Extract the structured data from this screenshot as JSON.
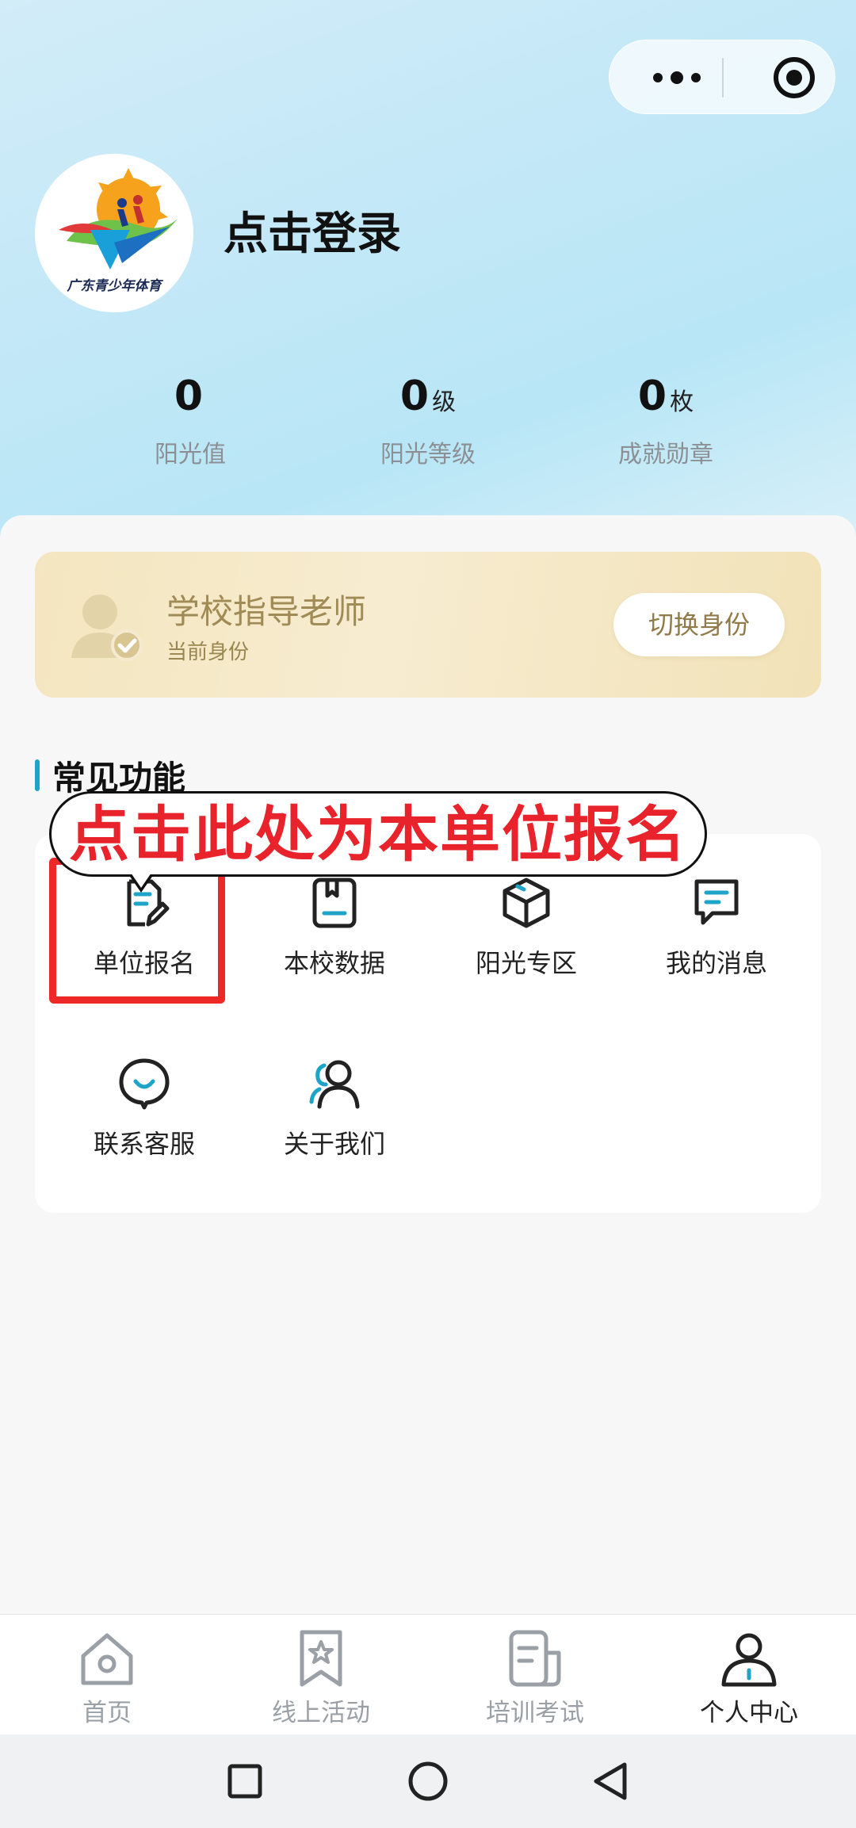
{
  "capsule": {
    "more_icon": "more-dots-icon",
    "close_icon": "target-icon"
  },
  "profile": {
    "logo_caption": "广东青少年体育",
    "login_text": "点击登录"
  },
  "stats": [
    {
      "value": "0",
      "unit": "",
      "label": "阳光值"
    },
    {
      "value": "0",
      "unit": "级",
      "label": "阳光等级"
    },
    {
      "value": "0",
      "unit": "枚",
      "label": "成就勋章"
    }
  ],
  "identity": {
    "title": "学校指导老师",
    "subtitle": "当前身份",
    "switch_label": "切换身份"
  },
  "section": {
    "title": "常见功能"
  },
  "annotation": {
    "text": "点击此处为本单位报名"
  },
  "functions": [
    {
      "label": "单位报名",
      "icon": "document-edit-icon"
    },
    {
      "label": "本校数据",
      "icon": "book-icon"
    },
    {
      "label": "阳光专区",
      "icon": "cube-icon"
    },
    {
      "label": "我的消息",
      "icon": "message-icon"
    },
    {
      "label": "联系客服",
      "icon": "customer-service-icon"
    },
    {
      "label": "关于我们",
      "icon": "users-icon"
    }
  ],
  "tabs": [
    {
      "label": "首页",
      "icon": "home-icon",
      "active": false
    },
    {
      "label": "线上活动",
      "icon": "activity-icon",
      "active": false
    },
    {
      "label": "培训考试",
      "icon": "exam-icon",
      "active": false
    },
    {
      "label": "个人中心",
      "icon": "user-icon",
      "active": true
    }
  ],
  "colors": {
    "accent": "#1ea3c9",
    "annotation_red": "#ee2727",
    "identity_gold": "#a08a55"
  }
}
